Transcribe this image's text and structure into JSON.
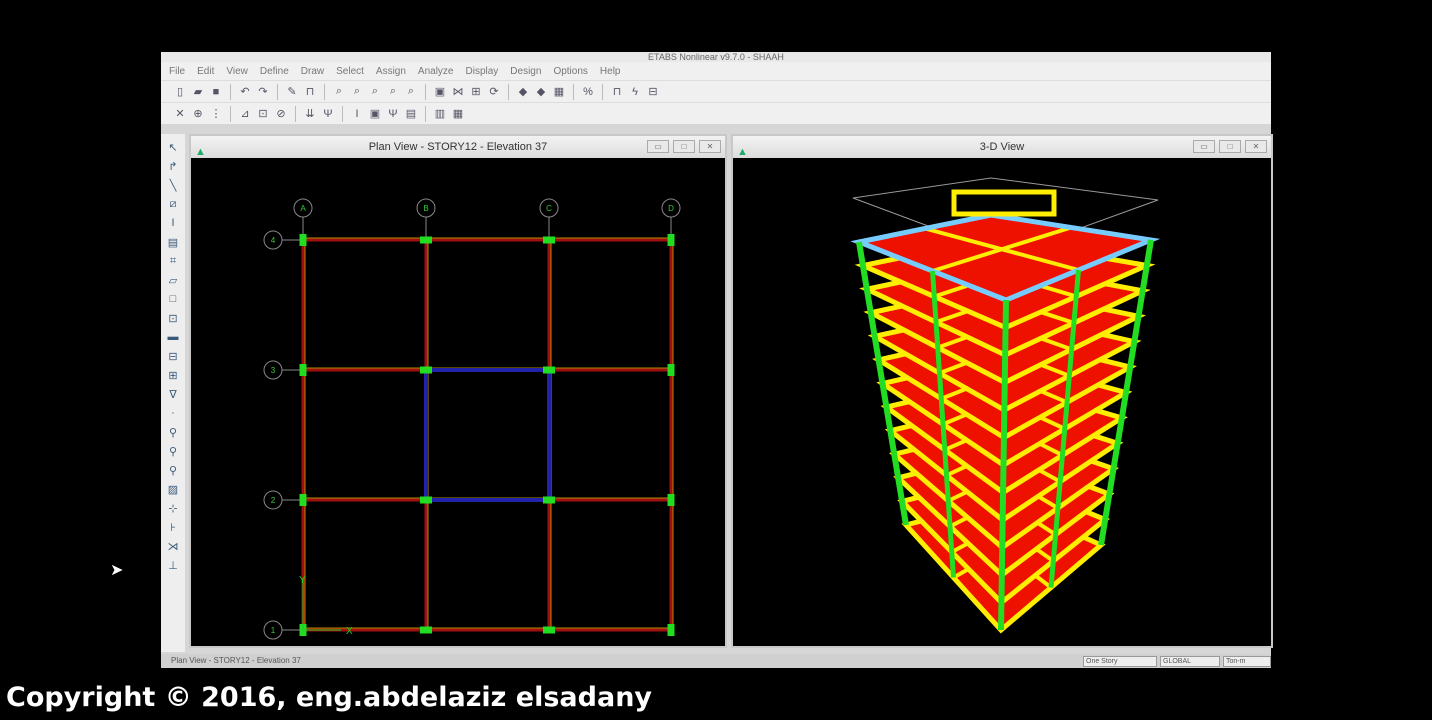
{
  "app": {
    "title": "ETABS Nonlinear v9.7.0 - SHAAH"
  },
  "menu": [
    "File",
    "Edit",
    "View",
    "Define",
    "Draw",
    "Select",
    "Assign",
    "Analyze",
    "Display",
    "Design",
    "Options",
    "Help"
  ],
  "plan_view": {
    "title": "Plan View - STORY12 - Elevation 37",
    "grid_x": [
      "A",
      "B",
      "C",
      "D"
    ],
    "grid_y": [
      "4",
      "3",
      "2",
      "1"
    ],
    "axis_x": "X",
    "axis_y": "Y"
  },
  "view_3d": {
    "title": "3-D View",
    "stories": 12
  },
  "status": {
    "text": "Plan View - STORY12 - Elevation 37",
    "story_mode": "One Story",
    "coord_system": "GLOBAL",
    "units": "Ton-m"
  },
  "copyright": "Copyright © 2016, eng.abdelaziz elsadany",
  "colors": {
    "column": "#22dd22",
    "beam": "#ffee00",
    "slab": "#ee1100",
    "grid": "#888888"
  }
}
